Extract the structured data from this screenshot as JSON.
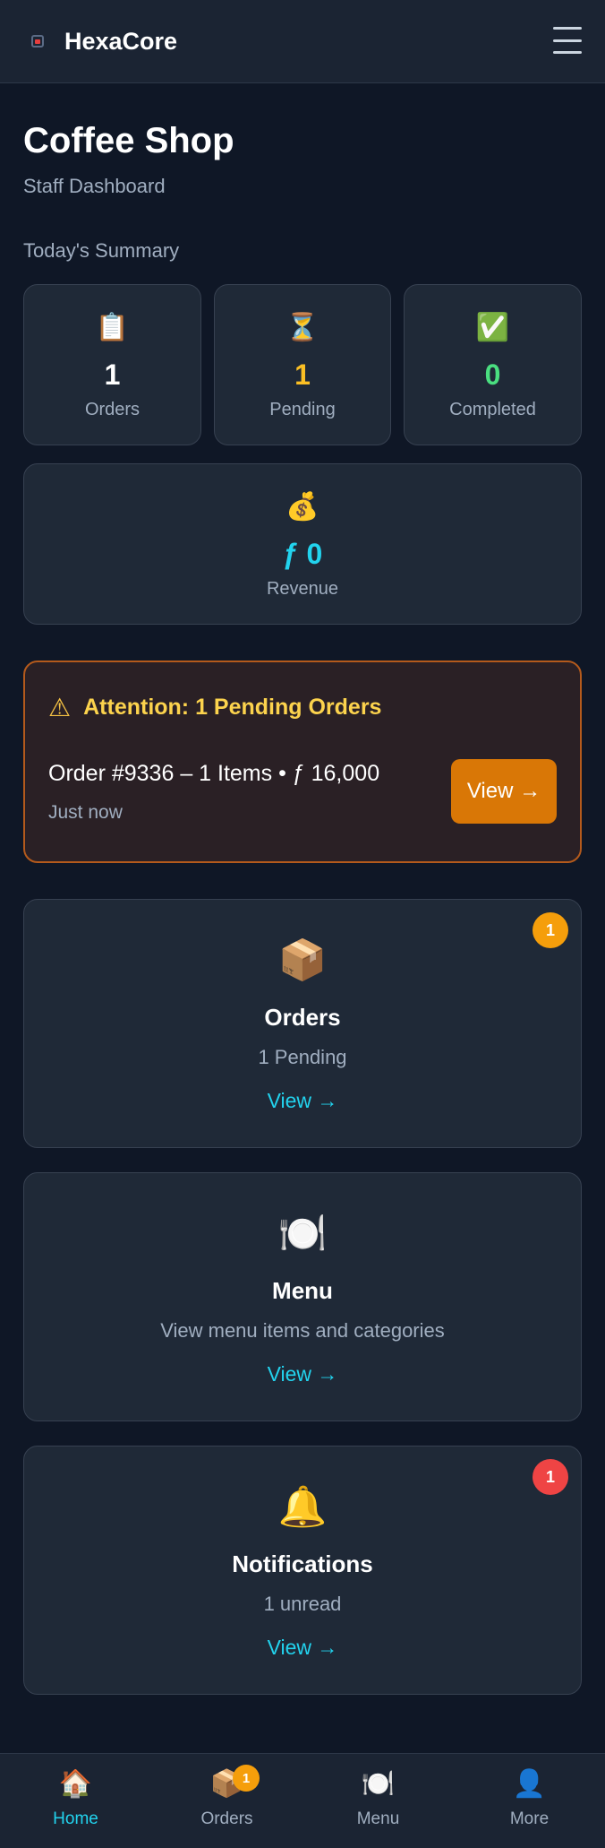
{
  "header": {
    "brand": "HexaCore",
    "menu_icon": "hamburger-icon"
  },
  "page": {
    "title": "Coffee Shop",
    "subtitle": "Staff Dashboard"
  },
  "summary": {
    "label": "Today's Summary",
    "stats": [
      {
        "icon": "📋",
        "value": "1",
        "label": "Orders",
        "color": "#ffffff"
      },
      {
        "icon": "⏳",
        "value": "1",
        "label": "Pending",
        "color": "#fbbf24"
      },
      {
        "icon": "✅",
        "value": "0",
        "label": "Completed",
        "color": "#4ade80"
      }
    ],
    "revenue": {
      "icon": "💰",
      "value": "ƒ 0",
      "label": "Revenue",
      "color": "#22d3ee"
    }
  },
  "attention": {
    "icon": "⚠",
    "title": "Attention: 1 Pending Orders",
    "order": "Order #9336 – 1 Items • ƒ 16,000",
    "time": "Just now",
    "button": "View →"
  },
  "cards": [
    {
      "icon": "📦",
      "title": "Orders",
      "subtitle": "1 Pending",
      "link": "View →",
      "badge": "1",
      "badge_color": "#f59e0b"
    },
    {
      "icon": "🍽️",
      "title": "Menu",
      "subtitle": "View menu items and categories",
      "link": "View →"
    },
    {
      "icon": "🔔",
      "title": "Notifications",
      "subtitle": "1 unread",
      "link": "View →",
      "badge": "1",
      "badge_color": "#ef4444"
    }
  ],
  "bottom_nav": {
    "items": [
      {
        "icon": "🏠",
        "label": "Home",
        "active": true
      },
      {
        "icon": "📦",
        "label": "Orders",
        "badge": "1"
      },
      {
        "icon": "🍽️",
        "label": "Menu"
      },
      {
        "icon": "👤",
        "label": "More"
      }
    ]
  }
}
